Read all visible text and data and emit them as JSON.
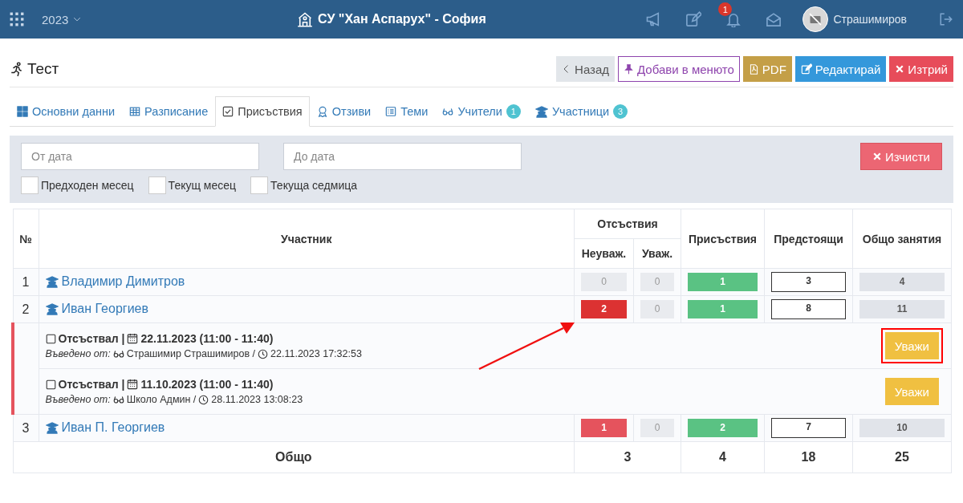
{
  "topbar": {
    "year": "2023",
    "school": "СУ \"Хан Аспарух\" - София",
    "notifications": "1",
    "user": "Страшимиров"
  },
  "page": {
    "title": "Тест"
  },
  "actions": [
    {
      "label": "Назад",
      "kind": "back"
    },
    {
      "label": "Добави в менюто",
      "kind": "pin"
    },
    {
      "label": "PDF",
      "kind": "pdf"
    },
    {
      "label": "Редактирай",
      "kind": "edit"
    },
    {
      "label": "Изтрий",
      "kind": "delete"
    }
  ],
  "tabs": [
    {
      "label": "Основни данни",
      "selected": false
    },
    {
      "label": "Разписание",
      "selected": false
    },
    {
      "label": "Присъствия",
      "selected": true
    },
    {
      "label": "Отзиви",
      "selected": false
    },
    {
      "label": "Теми",
      "selected": false
    },
    {
      "label": "Учители",
      "selected": false,
      "count": "1"
    },
    {
      "label": "Участници",
      "selected": false,
      "count": "3"
    }
  ],
  "filters": {
    "from_placeholder": "От дата",
    "to_placeholder": "До дата",
    "clear": "Изчисти",
    "checkboxes": [
      {
        "label": "Предходен месец",
        "checked": false
      },
      {
        "label": "Текущ месец",
        "checked": false
      },
      {
        "label": "Текуща седмица",
        "checked": false
      }
    ]
  },
  "table": {
    "headers": {
      "number": "№",
      "participant": "Участник",
      "absences": "Отсъствия",
      "unexcused": "Неуваж.",
      "excused": "Уваж.",
      "present": "Присъствия",
      "upcoming": "Предстоящи",
      "total": "Общо занятия"
    },
    "rows": [
      {
        "number": "1",
        "name": "Владимир Димитров",
        "expanded": false,
        "cells": [
          {
            "value": "0",
            "kind": "muted"
          },
          {
            "value": "0",
            "kind": "muted"
          },
          {
            "value": "1",
            "kind": "success"
          },
          {
            "value": "3",
            "kind": "outline"
          },
          {
            "value": "4",
            "kind": "neutral"
          }
        ]
      },
      {
        "number": "2",
        "name": "Иван Георгиев",
        "expanded": true,
        "cells": [
          {
            "value": "2",
            "kind": "danger"
          },
          {
            "value": "0",
            "kind": "muted"
          },
          {
            "value": "1",
            "kind": "success"
          },
          {
            "value": "8",
            "kind": "outline"
          },
          {
            "value": "11",
            "kind": "neutral"
          }
        ],
        "records": [
          {
            "status": "Отсъствал |",
            "date": "22.11.2023 (11:00 - 11:40)",
            "entered_label": "Въведено от:",
            "entered_by": "Страшимир Страшимиров /",
            "entered_at": "22.11.2023 17:32:53",
            "action": "Уважи",
            "highlighted": true
          },
          {
            "status": "Отсъствал |",
            "date": "11.10.2023 (11:00 - 11:40)",
            "entered_label": "Въведено от:",
            "entered_by": "Школо Админ /",
            "entered_at": "28.11.2023 13:08:23",
            "action": "Уважи",
            "highlighted": false
          }
        ]
      },
      {
        "number": "3",
        "name": "Иван П. Георгиев",
        "expanded": false,
        "cells": [
          {
            "value": "1",
            "kind": "danger"
          },
          {
            "value": "0",
            "kind": "muted"
          },
          {
            "value": "2",
            "kind": "success"
          },
          {
            "value": "7",
            "kind": "outline"
          },
          {
            "value": "10",
            "kind": "neutral"
          }
        ]
      }
    ],
    "totals": {
      "label": "Общо",
      "values": [
        "3",
        "4",
        "18",
        "25"
      ]
    }
  }
}
